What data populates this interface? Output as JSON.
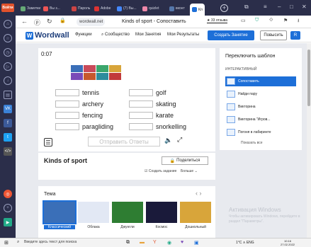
{
  "browser": {
    "logo": "Войти",
    "tabs": [
      {
        "label": "Заметки",
        "color": "#6a7"
      },
      {
        "label": "Вы з...",
        "color": "#e55"
      },
      {
        "label": "Пароль",
        "color": "#c44"
      },
      {
        "label": "Adobe",
        "color": "#d33"
      },
      {
        "label": "(7) Вы...",
        "color": "#48f"
      },
      {
        "label": "quizlet",
        "color": "#e8a"
      },
      {
        "label": "вконт",
        "color": "#57a"
      },
      {
        "label": "Кл",
        "color": "#1d6fd8"
      }
    ],
    "url": "wordwall.net",
    "page_title": "Kinds of sport - Сопоставить",
    "reviews": "★ 33 отзыва"
  },
  "site": {
    "logo": "Wordwall",
    "nav": [
      "Функции",
      "Сообщество",
      "Мои Занятия",
      "Мои Результаты"
    ],
    "create_label": "Создать Занятие",
    "upgrade_label": "Повысить",
    "avatar": "R"
  },
  "game": {
    "timer": "0:07",
    "words": [
      "tennis",
      "golf",
      "archery",
      "skating",
      "fencing",
      "karate",
      "paragliding",
      "snorkelling"
    ],
    "submit_label": "Отправить Ответы",
    "tile_colors": [
      "#3a6fb8",
      "#c94a5a",
      "#3ba66c",
      "#d8a53a",
      "#7a4ab8",
      "#c7582c",
      "#2e8c9c",
      "#c23a3a",
      "#4d8a3a"
    ]
  },
  "switch_panel": {
    "title": "Переключить шаблон",
    "subtitle": "ИНТЕРАКТИВНЫЙ",
    "items": [
      "Сопоставить",
      "Найди пару",
      "Викторина",
      "Викторина \"Игров...",
      "Погоня в лабиринте"
    ],
    "show_all": "Показать все"
  },
  "info": {
    "title": "Kinds of sport",
    "share_label": "Поделиться",
    "create_task": "Создать задание",
    "more": "Больше"
  },
  "theme": {
    "title": "Тема",
    "items": [
      {
        "label": "Классический",
        "color": "#3a6fb8"
      },
      {
        "label": "Облака",
        "color": "#e2e8f4"
      },
      {
        "label": "Джунгли",
        "color": "#2e7d32"
      },
      {
        "label": "Космос",
        "color": "#1a1a3a"
      },
      {
        "label": "Дошкольный",
        "color": "#d8a53a"
      }
    ]
  },
  "watermark": {
    "title": "Активация Windows",
    "text": "Чтобы активировать Windows, перейдите в раздел \"Параметры\"."
  },
  "taskbar": {
    "search": "Введите здесь текст для поиска",
    "weather": "1°C ∧ ENG",
    "time": "10:16",
    "date": "27.02.2022"
  }
}
